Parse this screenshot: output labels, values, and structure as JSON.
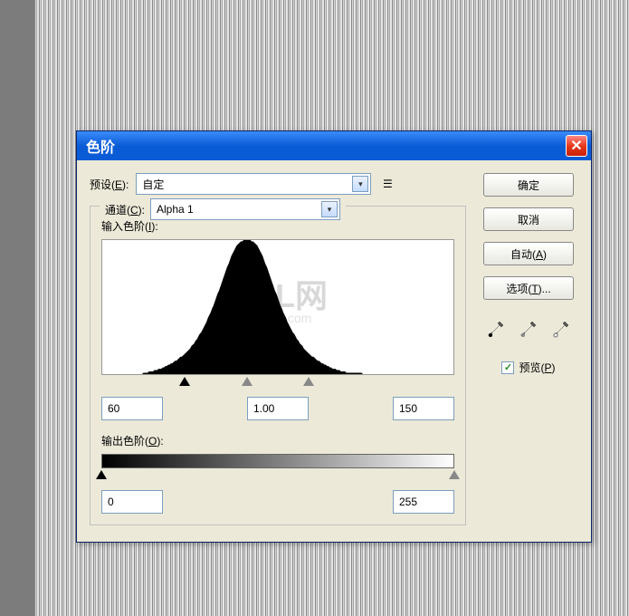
{
  "dialog": {
    "title": "色阶",
    "preset_label_pre": "预设(",
    "preset_label_u": "E",
    "preset_label_post": "):",
    "preset_value": "自定",
    "channel_label_pre": "通道(",
    "channel_label_u": "C",
    "channel_label_post": "):",
    "channel_value": "Alpha 1",
    "input_levels_label_pre": "输入色阶(",
    "input_levels_label_u": "I",
    "input_levels_label_post": "):",
    "input_black": "60",
    "input_gamma": "1.00",
    "input_white": "150",
    "output_levels_label_pre": "输出色阶(",
    "output_levels_label_u": "O",
    "output_levels_label_post": "):",
    "output_black": "0",
    "output_white": "255"
  },
  "buttons": {
    "ok": "确定",
    "cancel": "取消",
    "auto_pre": "自动(",
    "auto_u": "A",
    "auto_post": ")",
    "options_pre": "选项(",
    "options_u": "T",
    "options_post": ")..."
  },
  "preview": {
    "label_pre": "预览(",
    "label_u": "P",
    "label_post": ")",
    "checked": "✓"
  },
  "icons": {
    "close": "✕",
    "menu": "☰",
    "dropdown": "▾"
  },
  "watermark": {
    "main": "GXL网",
    "sub": "system.com"
  },
  "chart_data": {
    "type": "histogram",
    "title": "输入色阶",
    "xlabel": "",
    "ylabel": "",
    "xlim": [
      0,
      255
    ],
    "ylim": [
      0,
      100
    ],
    "description": "Approximately Gaussian histogram centered near luminance 110, spanning roughly 30 to 200, peak near full height",
    "values": [
      0,
      0,
      0,
      0,
      0,
      0,
      0,
      0,
      0,
      0,
      0,
      0,
      0,
      0,
      0,
      0,
      0,
      0,
      0,
      0,
      0,
      0,
      0,
      0,
      0,
      0,
      0,
      0,
      0,
      0,
      1,
      1,
      1,
      1,
      2,
      2,
      2,
      2,
      3,
      3,
      3,
      4,
      4,
      4,
      5,
      5,
      6,
      6,
      7,
      7,
      8,
      8,
      9,
      10,
      10,
      11,
      12,
      13,
      13,
      14,
      15,
      16,
      17,
      18,
      19,
      21,
      22,
      23,
      25,
      26,
      28,
      30,
      31,
      33,
      35,
      37,
      39,
      42,
      44,
      46,
      49,
      51,
      54,
      57,
      60,
      62,
      65,
      68,
      71,
      74,
      77,
      80,
      82,
      85,
      88,
      90,
      92,
      94,
      96,
      97,
      98,
      99,
      99,
      100,
      100,
      100,
      100,
      100,
      100,
      99,
      99,
      98,
      97,
      96,
      94,
      92,
      90,
      88,
      85,
      82,
      80,
      77,
      74,
      71,
      68,
      65,
      62,
      60,
      57,
      54,
      51,
      49,
      46,
      44,
      42,
      39,
      37,
      35,
      33,
      31,
      30,
      28,
      26,
      25,
      23,
      22,
      21,
      19,
      18,
      17,
      16,
      15,
      14,
      13,
      13,
      12,
      11,
      10,
      10,
      9,
      8,
      8,
      7,
      7,
      6,
      6,
      5,
      5,
      4,
      4,
      4,
      3,
      3,
      3,
      2,
      2,
      2,
      2,
      1,
      1,
      1,
      1,
      1,
      1,
      1,
      1,
      1,
      1,
      1,
      1,
      0,
      0,
      0,
      0,
      0,
      0,
      0,
      0,
      0,
      0,
      0,
      0,
      0,
      0,
      0,
      0,
      0,
      0,
      0,
      0,
      0,
      0,
      0,
      0,
      0,
      0,
      0,
      0,
      0,
      0,
      0,
      0,
      0,
      0,
      0,
      0,
      0,
      0,
      0,
      0,
      0,
      0,
      0,
      0,
      0,
      0,
      0,
      0,
      0,
      0,
      0,
      0,
      0,
      0,
      0,
      0,
      0,
      0,
      0,
      0,
      0,
      0,
      0,
      0,
      0,
      0
    ],
    "sliders": {
      "black": 60,
      "gamma": 1.0,
      "white": 150
    }
  }
}
